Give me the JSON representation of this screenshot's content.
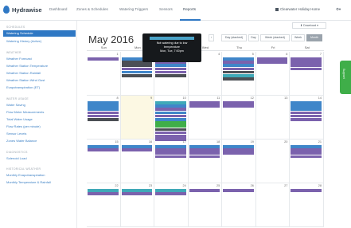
{
  "app": {
    "name": "Hydrawise"
  },
  "nav": {
    "items": [
      "Dashboard",
      "Zones & Schedules",
      "Watering Triggers",
      "Sensors",
      "Reports"
    ],
    "active_index": 4,
    "user": "Clearwater Holiday Home",
    "settings_icon": "gear-icon"
  },
  "sidebar": {
    "sections": [
      {
        "title": "SCHEDULES",
        "items": [
          "Watering Schedule",
          "Watering History (Active)"
        ]
      },
      {
        "title": "WEATHER",
        "items": [
          "Weather Forecast",
          "Weather Station Temperature",
          "Weather Station Rainfall",
          "Weather Station Wind Gust",
          "Evapotranspiration (ET)"
        ]
      },
      {
        "title": "WATER USAGE",
        "items": [
          "Water Saving",
          "Flow Meter Measurements",
          "Total Water Usage",
          "Flow Rates (per minute)",
          "Sensor Levels",
          "Zones Water Balance"
        ]
      },
      {
        "title": "DIAGNOSTICS",
        "items": [
          "Solenoid Load"
        ]
      },
      {
        "title": "HISTORICAL WEATHER",
        "items": [
          "Monthly Evapotranspiration",
          "Monthly Temperature & Rainfall"
        ]
      }
    ],
    "active_item": "Watering Schedule"
  },
  "calendar": {
    "month": "May 2016",
    "buttons": [
      "Day (stacked)",
      "Day",
      "Week (stacked)",
      "Week",
      "Month"
    ],
    "active_button": "Month",
    "download": "Download",
    "days_of_week": [
      "Sun",
      "Mon",
      "Tue",
      "Wed",
      "Thu",
      "Fri",
      "Sat"
    ],
    "today_index": 8,
    "weeks": [
      [
        1,
        2,
        3,
        4,
        5,
        6,
        7
      ],
      [
        8,
        9,
        10,
        11,
        12,
        13,
        14
      ],
      [
        15,
        16,
        17,
        18,
        19,
        20,
        21
      ],
      [
        22,
        23,
        24,
        25,
        26,
        27,
        28
      ]
    ]
  },
  "tooltip": {
    "lines": [
      "Not watering due to low",
      "temperature",
      "Mon, Tue, 7:00pm"
    ]
  },
  "side_tab": {
    "label": "Support"
  },
  "colors": {
    "primary": "#2f78c4",
    "event_blue": "#3f86c9",
    "event_purple": "#7b62ad",
    "event_teal": "#3fa9b8",
    "event_dark": "#4b4f55",
    "event_green": "#3fae49",
    "tooltip_bg": "#16191c",
    "today_bg": "#fcf8e3"
  },
  "events": {
    "0": [
      "purple"
    ],
    "1": [
      "blue",
      "dark",
      "dark",
      "purple",
      "blue",
      "dark"
    ],
    "2": [
      "blue",
      "purple",
      "blue",
      "purple",
      "purple",
      "dark"
    ],
    "3": [],
    "4": [
      "blue",
      "purple",
      "blue",
      "purple",
      "dark",
      "teal",
      "dark"
    ],
    "5": [
      "purple",
      "purple"
    ],
    "6": [
      "purple",
      "purple",
      "purple",
      "purple"
    ],
    "7": [
      "blue",
      "blue",
      "blue",
      "purple",
      "purple",
      "dark"
    ],
    "8": [],
    "9": [
      "teal",
      "blue",
      "purple",
      "blue",
      "purple",
      "blue",
      "green",
      "green",
      "dark",
      "purple",
      "purple",
      "purple"
    ],
    "10": [
      "purple",
      "purple"
    ],
    "11": [
      "purple",
      "purple"
    ],
    "12": [],
    "13": [
      "blue",
      "blue",
      "blue",
      "purple",
      "purple",
      "purple"
    ],
    "14": [
      "blue",
      "purple"
    ],
    "15": [
      "blue",
      "purple"
    ],
    "16": [
      "blue",
      "purple",
      "purple",
      "purple"
    ],
    "17": [
      "blue",
      "purple",
      "purple",
      "purple"
    ],
    "18": [
      "blue",
      "purple",
      "purple"
    ],
    "19": [],
    "20": [
      "blue",
      "purple",
      "purple",
      "purple"
    ],
    "21": [
      "teal",
      "purple"
    ],
    "22": [
      "teal",
      "purple"
    ],
    "23": [
      "teal",
      "purple"
    ],
    "24": [
      "purple"
    ],
    "25": [
      "purple"
    ],
    "26": [],
    "27": [
      "purple"
    ]
  }
}
